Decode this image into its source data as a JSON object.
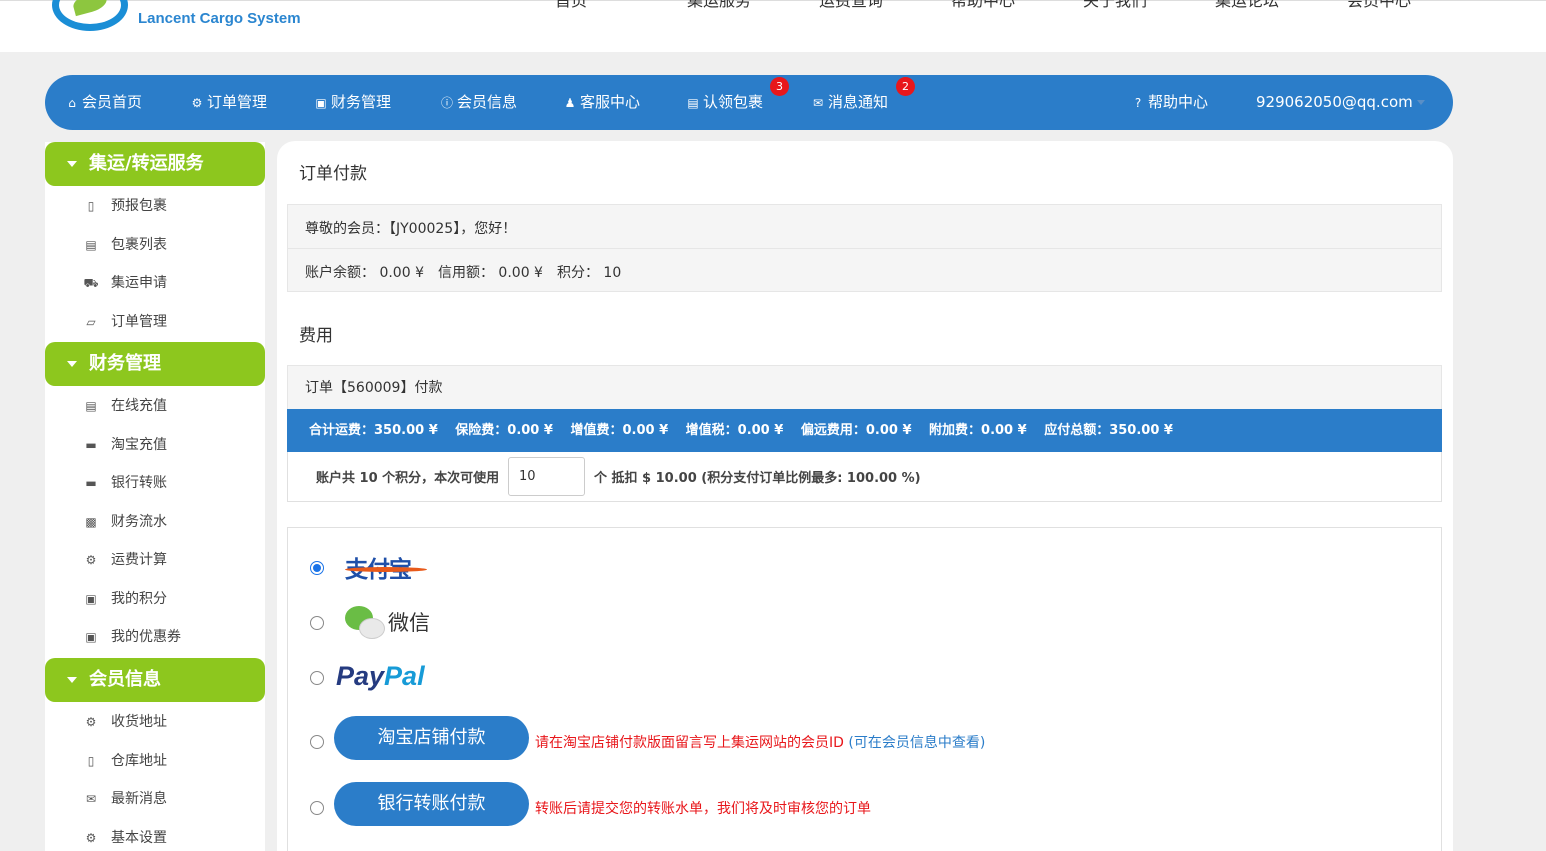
{
  "brand": {
    "name": "Lancent Cargo System"
  },
  "top_nav": [
    {
      "label": "首页"
    },
    {
      "label": "集运服务"
    },
    {
      "label": "运费查询"
    },
    {
      "label": "帮助中心"
    },
    {
      "label": "关于我们"
    },
    {
      "label": "集运论坛"
    },
    {
      "label": "会员中心"
    }
  ],
  "main_nav": {
    "home": "会员首页",
    "orders": "订单管理",
    "finance": "财务管理",
    "member_info": "会员信息",
    "service": "客服中心",
    "claim_parcel": "认领包裹",
    "claim_badge": "3",
    "messages": "消息通知",
    "messages_badge": "2",
    "help": "帮助中心",
    "user": "929062050@qq.com"
  },
  "sidebar": {
    "sections": [
      {
        "title": "集运/转运服务",
        "items": [
          {
            "label": "预报包裹",
            "icon": "inbox-icon"
          },
          {
            "label": "包裹列表",
            "icon": "list-icon"
          },
          {
            "label": "集运申请",
            "icon": "truck-icon"
          },
          {
            "label": "订单管理",
            "icon": "book-icon"
          }
        ]
      },
      {
        "title": "财务管理",
        "items": [
          {
            "label": "在线充值",
            "icon": "server-icon"
          },
          {
            "label": "淘宝充值",
            "icon": "credit-card-icon"
          },
          {
            "label": "银行转账",
            "icon": "credit-card-icon"
          },
          {
            "label": "财务流水",
            "icon": "bar-chart-icon"
          },
          {
            "label": "运费计算",
            "icon": "cogs-icon"
          },
          {
            "label": "我的积分",
            "icon": "gift-icon"
          },
          {
            "label": "我的优惠券",
            "icon": "gift-icon"
          }
        ]
      },
      {
        "title": "会员信息",
        "items": [
          {
            "label": "收货地址",
            "icon": "cogs-icon"
          },
          {
            "label": "仓库地址",
            "icon": "building-icon"
          },
          {
            "label": "最新消息",
            "icon": "envelope-icon"
          },
          {
            "label": "基本设置",
            "icon": "gear-icon"
          }
        ]
      }
    ]
  },
  "content": {
    "title": "订单付款",
    "greeting": "尊敬的会员：【JY00025】，您好！",
    "balance_line": "账户余额： 0.00 ¥　信用额： 0.00 ¥　积分： 10",
    "fee_title": "费用",
    "order_head": "订单【560009】付款",
    "fees": [
      "合计运费：350.00 ¥",
      "保险费：0.00 ¥",
      "增值费：0.00 ¥",
      "增值税：0.00 ¥",
      "偏远费用：0.00 ¥",
      "附加费：0.00 ¥",
      "应付总额：350.00 ¥"
    ],
    "points_prefix": "账户共 10 个积分，本次可使用",
    "points_value": "10",
    "points_suffix": "个 抵扣 $ 10.00 (积分支付订单比例最多: 100.00 %)",
    "payment": {
      "alipay_label": "支付宝",
      "wechat_label": "微信",
      "paypal_p1": "Pay",
      "paypal_p2": "Pal",
      "taobao_button": "淘宝店铺付款",
      "taobao_note": "请在淘宝店铺付款版面留言写上集运网站的会员ID",
      "taobao_note_link": "(可在会员信息中查看)",
      "bank_button": "银行转账付款",
      "bank_note": "转账后请提交您的转账水单，我们将及时审核您的订单",
      "selected": "alipay"
    }
  }
}
